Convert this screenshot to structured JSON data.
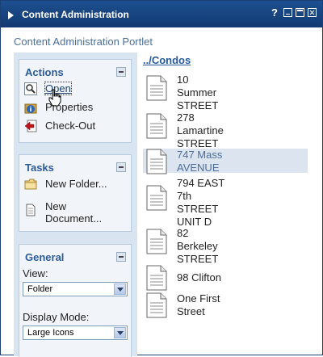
{
  "window": {
    "title": "Content Administration",
    "help_label": "?",
    "subtitle": "Content Administration Portlet"
  },
  "actions": {
    "header": "Actions",
    "items": [
      {
        "label": "Open",
        "icon": "magnifier-icon"
      },
      {
        "label": "Properties",
        "icon": "info-icon"
      },
      {
        "label": "Check-Out",
        "icon": "checkout-icon"
      }
    ]
  },
  "tasks": {
    "header": "Tasks",
    "items": [
      {
        "label": "New Folder...",
        "icon": "folder-icon"
      },
      {
        "label": "New\nDocument...",
        "icon": "document-icon"
      }
    ]
  },
  "general": {
    "header": "General",
    "view_label": "View:",
    "view_value": "Folder",
    "display_mode_label": "Display Mode:",
    "display_mode_value": "Large Icons"
  },
  "breadcrumb": "../Condos",
  "files": [
    {
      "name": "10\nSummer\nSTREET"
    },
    {
      "name": "278\nLamartine\nSTREET"
    },
    {
      "name": "747 Mass\nAVENUE",
      "selected": true
    },
    {
      "name": "794 EAST\n7th\nSTREET\nUNIT D"
    },
    {
      "name": "82\nBerkeley\nSTREET"
    },
    {
      "name": "98 Clifton"
    },
    {
      "name": "One First\nStreet"
    }
  ],
  "colors": {
    "titlebar": "#1a4580",
    "link": "#26589a",
    "selected_row": "#dbe4ef"
  }
}
